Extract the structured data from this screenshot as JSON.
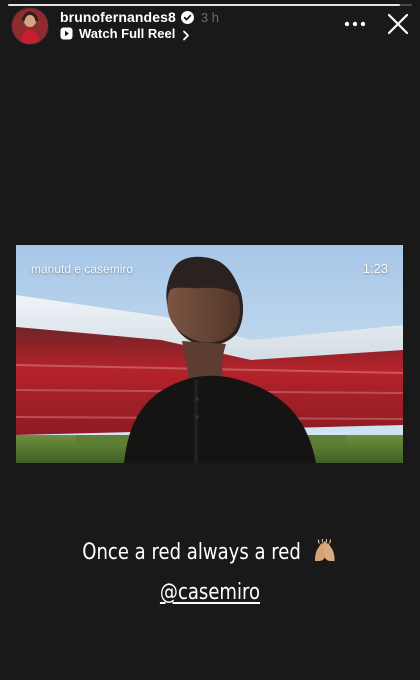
{
  "story": {
    "progress": 0.97
  },
  "header": {
    "username": "brunofernandes8",
    "post_age": "3 h",
    "watch_label": "Watch Full Reel",
    "avatar_icon": "avatar-photo",
    "verified_icon": "verified-badge-icon",
    "reel_icon": "reel-play-icon",
    "more_icon": "more-horizontal-icon",
    "close_icon": "close-icon"
  },
  "reel": {
    "handle": "manutd e casemiro",
    "duration": "1:23"
  },
  "caption": {
    "line1": "Once a red always a red",
    "line1_emoji": "raised-hands-emoji",
    "mention": "@casemiro"
  },
  "colors": {
    "background": "#191919",
    "verified": "#ffffff",
    "stadium_red": "#b8201f"
  }
}
